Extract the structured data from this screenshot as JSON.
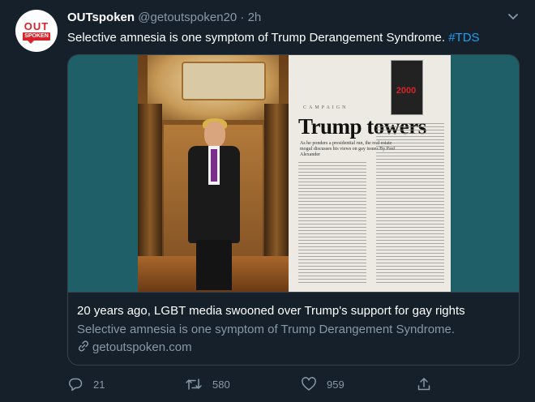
{
  "author": {
    "avatar_logo_top": "OUT",
    "avatar_logo_bottom": "SPOKEN",
    "name": "OUTspoken",
    "handle": "@getoutspoken20",
    "separator": "·",
    "time": "2h"
  },
  "tweet": {
    "text": "Selective amnesia is one symptom of Trump Derangement Syndrome.",
    "hashtag": "#TDS"
  },
  "card": {
    "image": {
      "tag": "CAMPAIGN",
      "headline": "Trump towers",
      "subhead": "As he ponders a presidential run, the real estate mogul discusses his views on gay issues By Paul Alexander",
      "book_year": "2000"
    },
    "title": "20 years ago, LGBT media swooned over Trump's support for gay rights",
    "description": "Selective amnesia is one symptom of Trump Derangement Syndrome.",
    "domain": "getoutspoken.com"
  },
  "actions": {
    "reply_count": "21",
    "retweet_count": "580",
    "like_count": "959"
  },
  "colors": {
    "background": "#15202b",
    "secondary_text": "#8899a6",
    "accent": "#1da1f2",
    "brand": "#d8232a"
  },
  "icons": [
    "chevron-down-icon",
    "link-icon",
    "reply-icon",
    "retweet-icon",
    "like-icon",
    "share-icon"
  ]
}
